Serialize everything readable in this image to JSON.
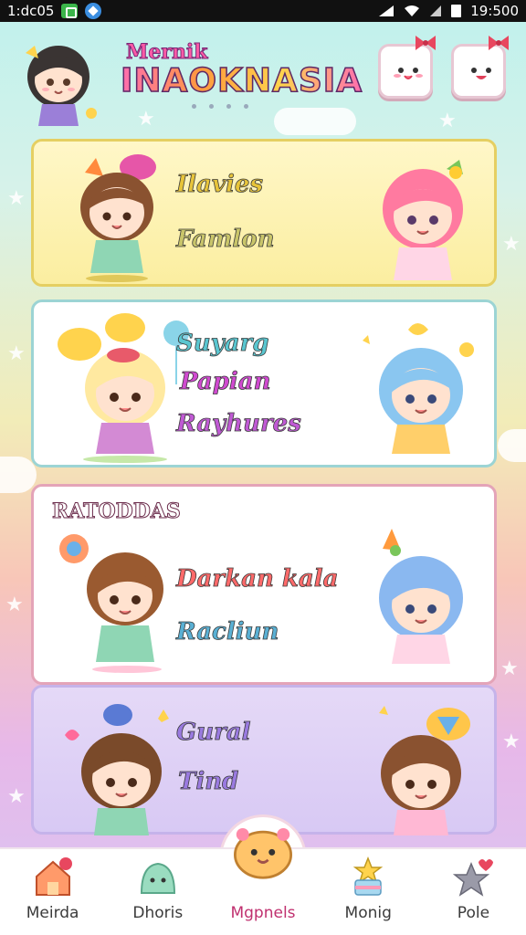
{
  "status_bar": {
    "left_text": "1:dc05",
    "time": "19:500"
  },
  "header": {
    "title_small": "Mernik",
    "title_big": "INAOKNASIA"
  },
  "cards": {
    "c1": {
      "items": [
        "Ilavies",
        "Famlon"
      ]
    },
    "c2": {
      "items": [
        "Suyarg",
        "Papian",
        "Rayhures"
      ]
    },
    "c3": {
      "heading": "RATODDAS",
      "items": [
        "Darkan kala",
        "Racliun"
      ]
    },
    "c4": {
      "items": [
        "Gural",
        "Tind"
      ]
    }
  },
  "nav": {
    "items": [
      {
        "label": "Meirda",
        "icon": "house-icon"
      },
      {
        "label": "Dhoris",
        "icon": "slime-icon"
      },
      {
        "label": "Mgpnels",
        "icon": "bun-face-icon",
        "active": true
      },
      {
        "label": "Monig",
        "icon": "star-cake-icon"
      },
      {
        "label": "Pole",
        "icon": "heart-star-icon"
      }
    ]
  },
  "colors": {
    "accent": "#ff5aa6",
    "card1_border": "#e5cf62",
    "card2_border": "#9cd4d4",
    "card3_border": "#e4a4b8",
    "card4_border": "#c5b3ea"
  }
}
